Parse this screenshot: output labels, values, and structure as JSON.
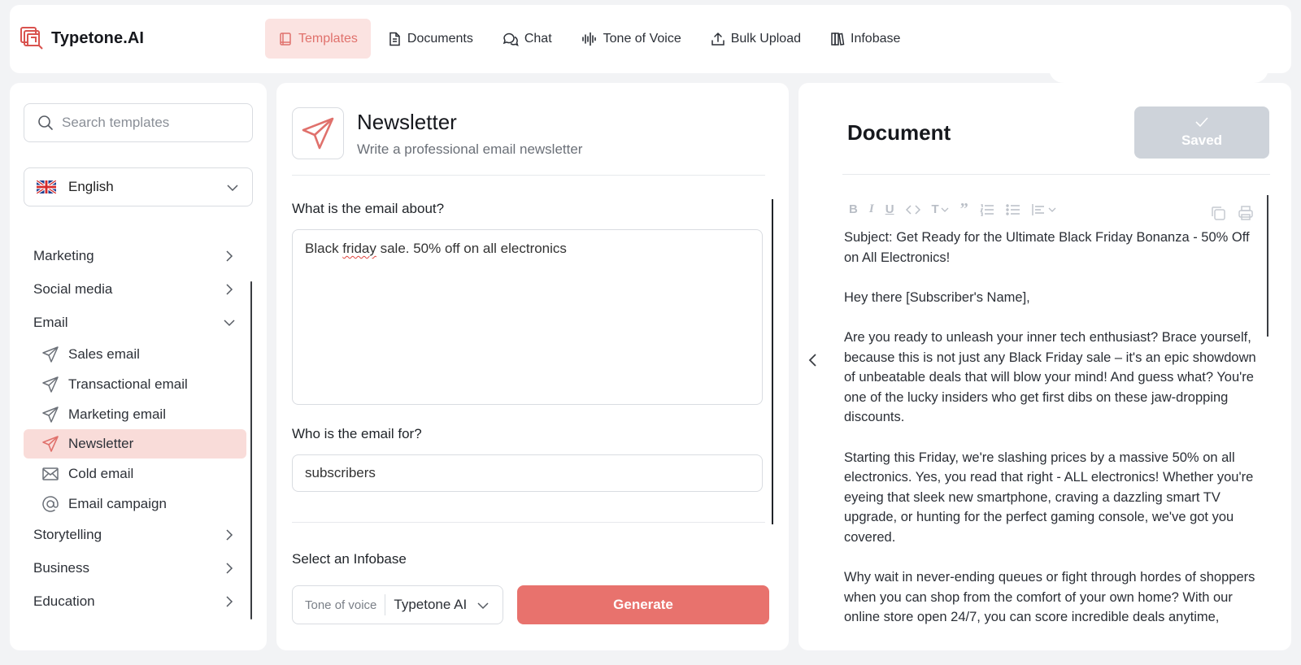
{
  "brand": {
    "name": "Typetone.AI"
  },
  "nav": [
    {
      "label": "Templates",
      "icon": "book-icon",
      "active": true
    },
    {
      "label": "Documents",
      "icon": "document-icon"
    },
    {
      "label": "Chat",
      "icon": "chat-bubbles-icon"
    },
    {
      "label": "Tone of Voice",
      "icon": "sound-wave-icon"
    },
    {
      "label": "Bulk Upload",
      "icon": "upload-icon"
    },
    {
      "label": "Infobase",
      "icon": "library-icon"
    }
  ],
  "sidebar": {
    "search_placeholder": "Search templates",
    "language": "English",
    "categories": [
      {
        "label": "Marketing",
        "expanded": false
      },
      {
        "label": "Social media",
        "expanded": false
      },
      {
        "label": "Email",
        "expanded": true
      },
      {
        "label": "Storytelling",
        "expanded": false
      },
      {
        "label": "Business",
        "expanded": false
      },
      {
        "label": "Education",
        "expanded": false
      }
    ],
    "email_templates": [
      {
        "label": "Sales email",
        "icon": "paper-plane-icon"
      },
      {
        "label": "Transactional email",
        "icon": "paper-plane-icon"
      },
      {
        "label": "Marketing email",
        "icon": "paper-plane-icon"
      },
      {
        "label": "Newsletter",
        "icon": "paper-plane-icon",
        "active": true
      },
      {
        "label": "Cold email",
        "icon": "envelope-icon"
      },
      {
        "label": "Email campaign",
        "icon": "at-sign-icon"
      }
    ]
  },
  "template": {
    "title": "Newsletter",
    "subtitle": "Write a professional email newsletter",
    "q1_label": "What is the email about?",
    "q1_value_pre": "Black ",
    "q1_value_misspelled": "friday",
    "q1_value_post": " sale. 50% off on all electronics",
    "q2_label": "Who is the email for?",
    "q2_value": "subscribers",
    "infobase_label": "Select an Infobase",
    "tone_label": "Tone of voice",
    "tone_value": "Typetone AI",
    "generate_label": "Generate"
  },
  "document": {
    "title": "Document",
    "saved_label": "Saved",
    "toolbar": [
      "bold",
      "italic",
      "underline",
      "code",
      "text-style",
      "quote",
      "ordered-list",
      "bullet-list",
      "align"
    ],
    "paragraphs": [
      "Subject: Get Ready for the Ultimate Black Friday Bonanza - 50% Off on All Electronics!",
      "Hey there [Subscriber's Name],",
      "Are you ready to unleash your inner tech enthusiast? Brace yourself, because this is not just any Black Friday sale – it's an epic showdown of unbeatable deals that will blow your mind! And guess what? You're one of the lucky insiders who get first dibs on these jaw-dropping discounts.",
      "Starting this Friday, we're slashing prices by a massive 50% on all electronics. Yes, you read that right - ALL electronics! Whether you're eyeing that sleek new smartphone, craving a dazzling smart TV upgrade, or hunting for the perfect gaming console, we've got you covered.",
      "Why wait in never-ending queues or fight through hordes of shoppers when you can shop from the comfort of your own home? With our online store open 24/7, you can score incredible deals anytime, anywhere."
    ]
  },
  "colors": {
    "accent": "#e8726d",
    "accent_light": "#fbe3e1",
    "saved_bg": "#ced3da"
  }
}
